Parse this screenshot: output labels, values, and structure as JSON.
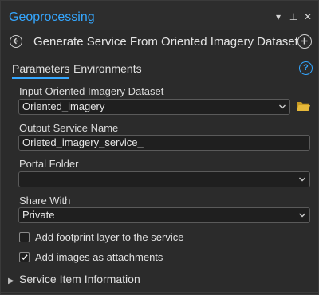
{
  "window": {
    "title": "Geoprocessing",
    "controls": {
      "menu": "▾",
      "pin": "⊥",
      "close": "✕"
    }
  },
  "tool": {
    "title": "Generate Service From Oriented Imagery Dataset"
  },
  "tabs": [
    {
      "label": "Parameters",
      "active": true
    },
    {
      "label": "Environments",
      "active": false
    }
  ],
  "help": "?",
  "params": {
    "input_dataset": {
      "label": "Input Oriented Imagery Dataset",
      "value": "Oriented_imagery"
    },
    "output_service": {
      "label": "Output Service Name",
      "value": "Orieted_imagery_service_"
    },
    "portal_folder": {
      "label": "Portal Folder",
      "value": ""
    },
    "share_with": {
      "label": "Share With",
      "value": "Private"
    },
    "add_footprint": {
      "label": "Add footprint layer to the service",
      "checked": false
    },
    "add_images": {
      "label": "Add images as attachments",
      "checked": true
    }
  },
  "section": {
    "label": "Service Item Information",
    "expanded": false
  },
  "colors": {
    "accent": "#35a7ff",
    "background": "#2b2b2b",
    "field_bg": "#1f1f1f",
    "folder": "#e7b93a"
  },
  "icons": {
    "back": "back-arrow-icon",
    "add": "add-circle-icon",
    "help": "help-icon",
    "folder": "folder-icon",
    "dropdown": "chevron-down-icon",
    "expand": "chevron-right-icon"
  }
}
